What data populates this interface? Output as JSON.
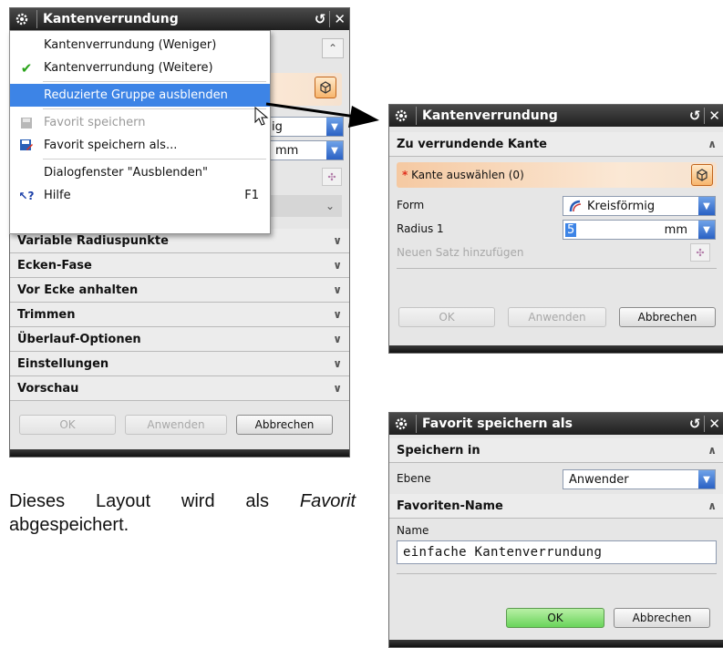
{
  "main_dialog": {
    "title": "Kantenverrundung",
    "partial_units": "mm",
    "partial_combo": "ig",
    "groups": [
      "Variable Radiuspunkte",
      "Ecken-Fase",
      "Vor Ecke anhalten",
      "Trimmen",
      "Überlauf-Optionen",
      "Einstellungen",
      "Vorschau"
    ],
    "buttons": {
      "ok": "OK",
      "apply": "Anwenden",
      "cancel": "Abbrechen"
    }
  },
  "context_menu": {
    "items": [
      {
        "label": "Kantenverrundung (Weniger)",
        "icon": "none"
      },
      {
        "label": "Kantenverrundung (Weitere)",
        "icon": "checkmark-icon"
      },
      {
        "label": "Reduzierte Gruppe ausblenden",
        "icon": "none",
        "highlighted": true
      },
      {
        "label": "Favorit speichern",
        "icon": "save-icon",
        "disabled": true
      },
      {
        "label": "Favorit speichern als...",
        "icon": "save-as-icon"
      },
      {
        "label": "Dialogfenster \"Ausblenden\"",
        "icon": "none"
      },
      {
        "label": "Hilfe",
        "icon": "help-icon",
        "shortcut": "F1"
      }
    ]
  },
  "reduced_dialog": {
    "title": "Kantenverrundung",
    "group": "Zu verrundende Kante",
    "select_label": "Kante auswählen (0)",
    "required_mark": "*",
    "form_label": "Form",
    "form_value": "Kreisförmig",
    "radius_label": "Radius 1",
    "radius_value": "5",
    "radius_units": "mm",
    "add_set_label": "Neuen Satz hinzufügen",
    "buttons": {
      "ok": "OK",
      "apply": "Anwenden",
      "cancel": "Abbrechen"
    }
  },
  "favorite_dialog": {
    "title": "Favorit speichern als",
    "group1": "Speichern in",
    "level_label": "Ebene",
    "level_value": "Anwender",
    "group2": "Favoriten-Name",
    "name_label": "Name",
    "name_value": "einfache Kantenverrundung",
    "buttons": {
      "ok": "OK",
      "cancel": "Abbrechen"
    }
  },
  "caption": {
    "part1": "Dieses Layout wird als",
    "italic": "Favorit",
    "part2": "abgespeichert."
  },
  "colors": {
    "title_bar": "#2b2b2b",
    "highlight": "#3d84e6",
    "required": "#e0301e",
    "ok_green": "#69d45a"
  }
}
